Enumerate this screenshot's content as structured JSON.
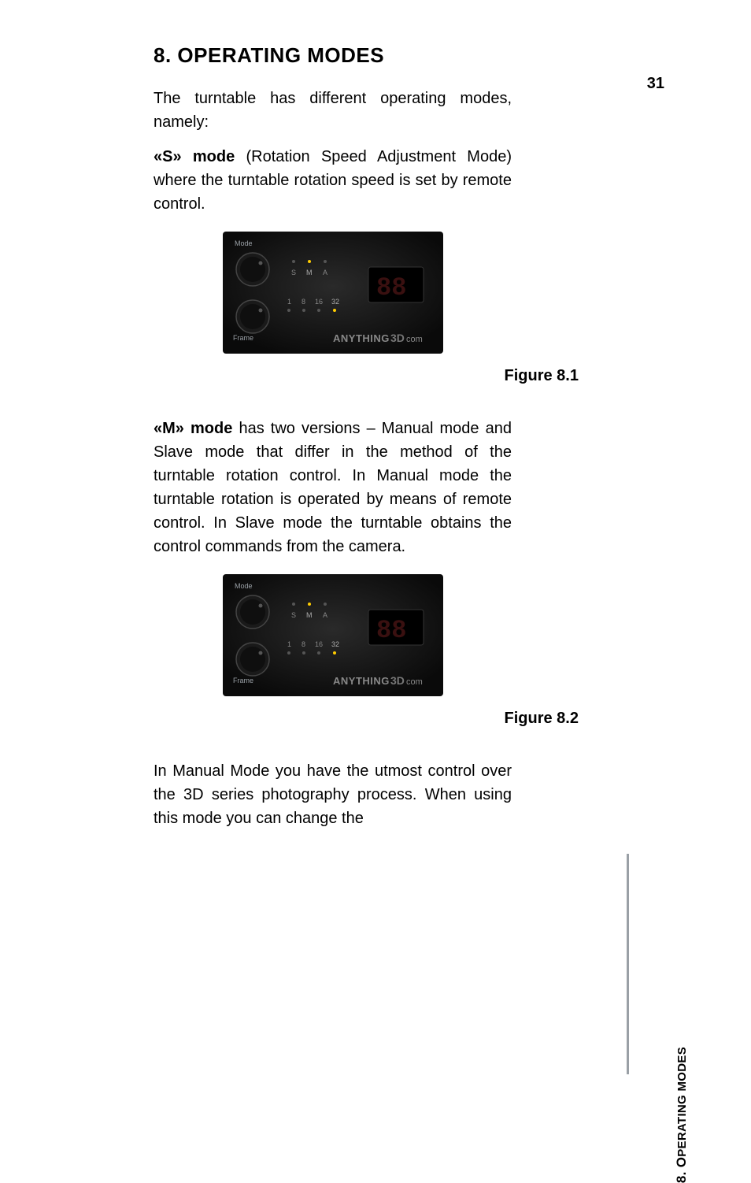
{
  "page_number": "31",
  "section_title": "8. OPERATING MODES",
  "intro": "The turntable has different operating modes, namely:",
  "s_mode_label": "«S» mode",
  "s_mode_text": " (Rotation Speed Adjustment Mode) where the turntable rotation speed is set by remote control.",
  "figure1_caption": "Figure 8.1",
  "m_mode_label": "«M» mode",
  "m_mode_text": " has two versions  –   Manual mode and Slave mode that differ in the method of the turntable rotation control. In Manual mode the turntable rotation is operated by means of remote control. In Slave mode the turntable obtains the control commands from the camera.",
  "figure2_caption": "Figure 8.2",
  "manual_para": "In Manual Mode you have the utmost control over the 3D series photography process. When using this mode you can change the",
  "side_tab_prefix": "8. O",
  "side_tab_rest": "PERATING MODES",
  "panel": {
    "mode_label": "Mode",
    "frame_label": "Frame",
    "row1_labels": [
      "S",
      "M",
      "A"
    ],
    "row2_labels": [
      "1",
      "8",
      "16",
      "32"
    ],
    "brand": "ANYTHING 3Dcom",
    "display": "88"
  }
}
